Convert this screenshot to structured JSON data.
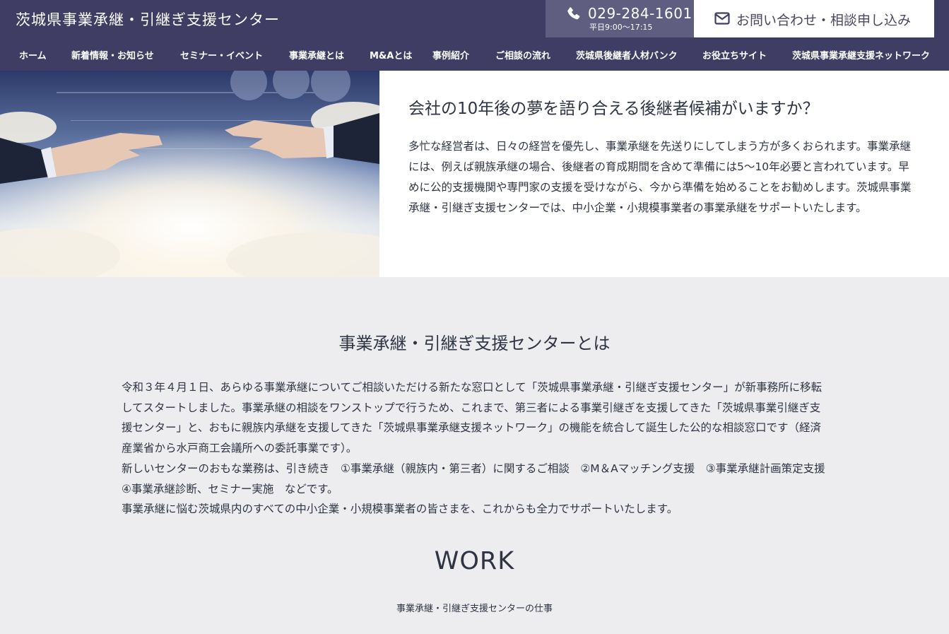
{
  "header": {
    "site_title": "茨城県事業承継・引継ぎ支援センター",
    "phone_number": "029-284-1601",
    "phone_hours": "平日9:00〜17:15",
    "contact_label": "お問い合わせ・相談申し込み",
    "phone_icon": "phone-icon",
    "mail_icon": "envelope-icon"
  },
  "nav": {
    "items": [
      "ホーム",
      "新着情報・お知らせ",
      "セミナー・イベント",
      "事業承継とは",
      "M&Aとは",
      "事例紹介",
      "ご相談の流れ",
      "茨城県後継者人材バンク",
      "お役立ちサイト",
      "茨城県事業承継支援ネットワーク"
    ]
  },
  "hero": {
    "image_subject": "handshake-over-clouds",
    "heading": "会社の10年後の夢を語り合える後継者候補がいますか？",
    "body": "多忙な経営者は、日々の経営を優先し、事業承継を先送りにしてしまう方が多くおられます。事業承継には、例えば親族承継の場合、後継者の育成期間を含めて準備には5〜10年必要と言われています。早めに公的支援機関や専門家の支援を受けながら、今から準備を始めることをお勧めします。茨城県事業承継・引継ぎ支援センターでは、中小企業・小規模事業者の事業承継をサポートいたします。"
  },
  "about": {
    "title": "事業承継・引継ぎ支援センターとは",
    "paragraphs": [
      "令和３年４月１日、あらゆる事業承継についてご相談いただける新たな窓口として「茨城県事業承継・引継ぎ支援センター」が新事務所に移転してスタートしました。事業承継の相談をワンストップで行うため、これまで、第三者による事業引継ぎを支援してきた「茨城県事業引継ぎ支援センター」と、おもに親族内承継を支援してきた「茨城県事業承継支援ネットワーク」の機能を統合して誕生した公的な相談窓口です（経済産業省から水戸商工会議所への委託事業です）。",
      "新しいセンターのおもな業務は、引き続き　①事業承継（親族内・第三者）に関するご相談　②M＆Aマッチング支援　③事業承継計画策定支援　④事業承継診断、セミナー実施　などです。",
      "事業承継に悩む茨城県内のすべての中小企業・小規模事業者の皆さまを、これからも全力でサポートいたします。"
    ]
  },
  "work": {
    "title": "WORK",
    "subtitle": "事業承継・引継ぎ支援センターの仕事"
  },
  "colors": {
    "header_bg": "#3f3d63",
    "phone_bg": "#5f5d80",
    "page_bg": "#ededf0",
    "text": "#2e3442"
  }
}
